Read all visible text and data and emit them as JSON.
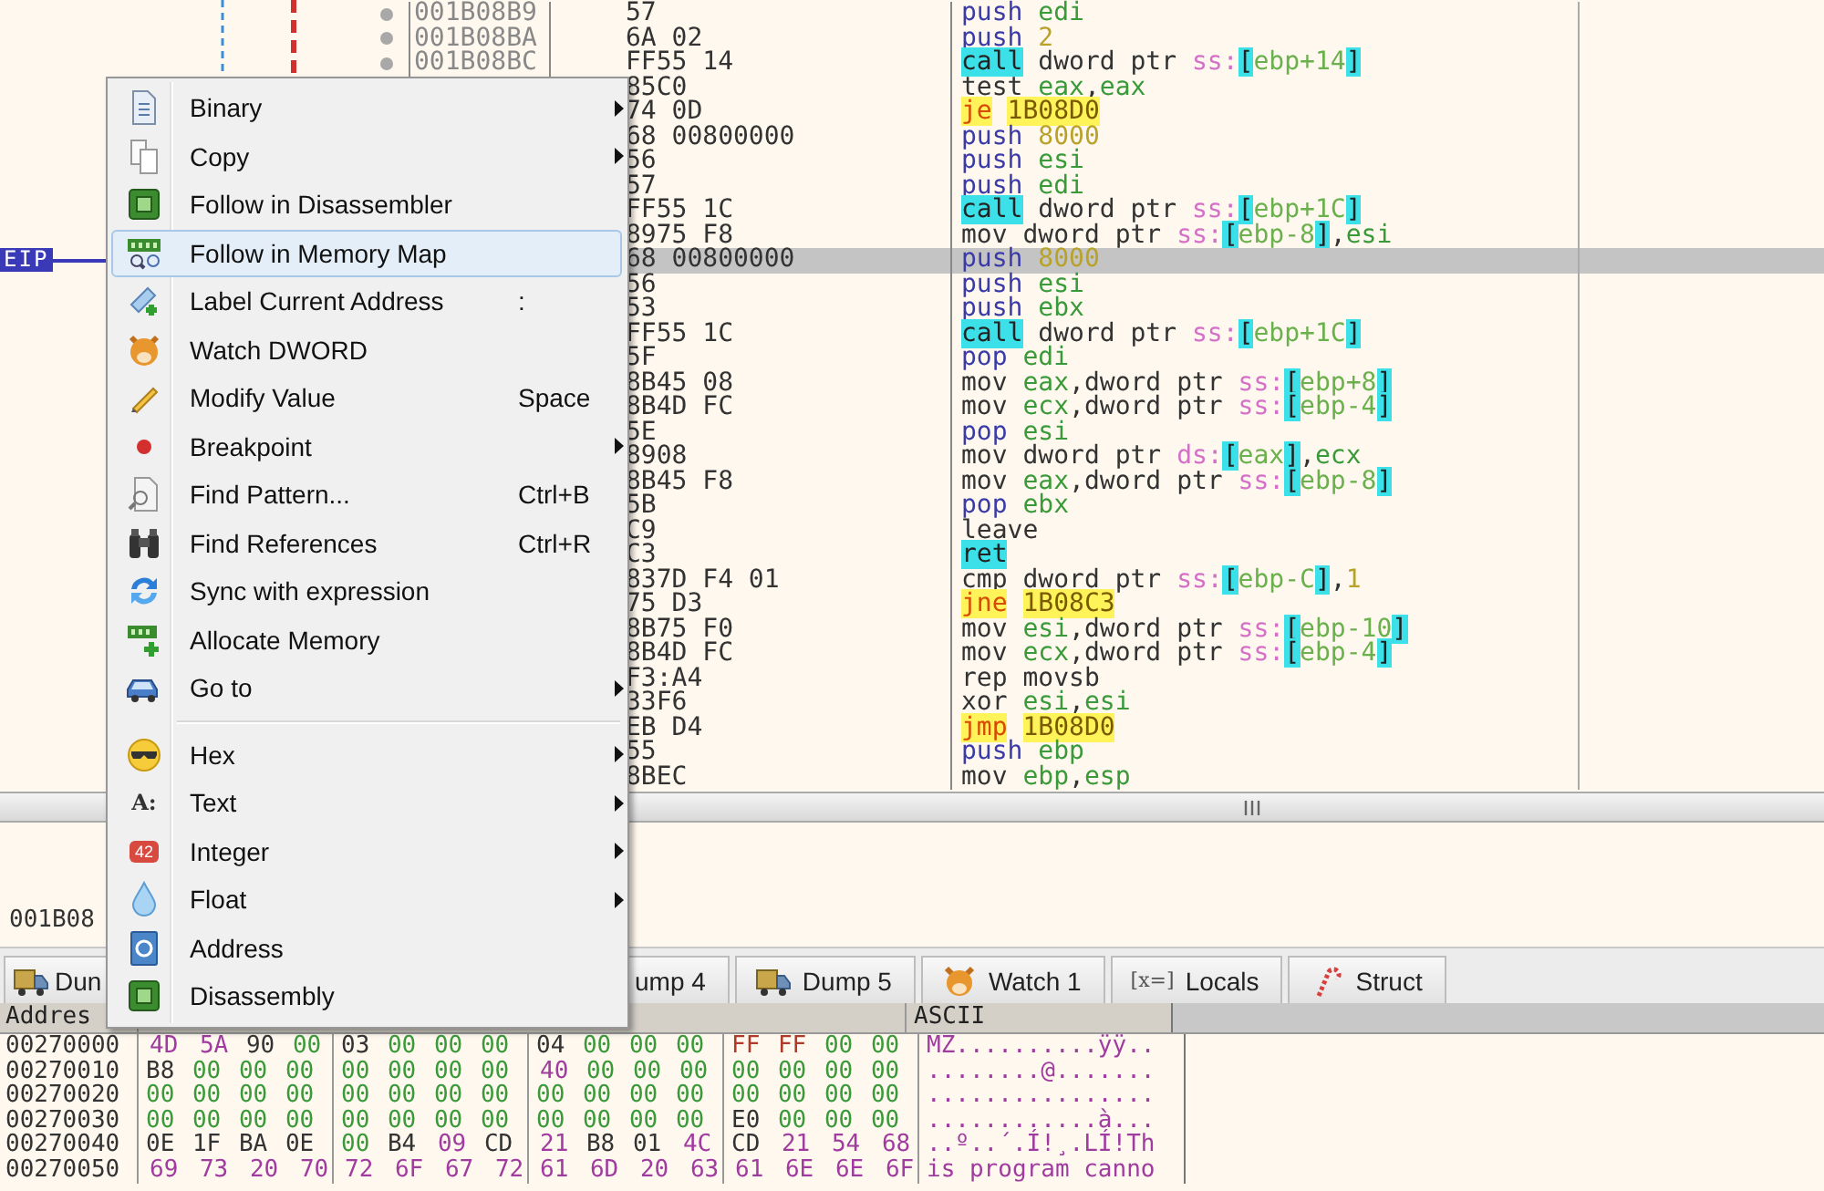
{
  "disassembly": {
    "rows": [
      {
        "address": "001B08B9",
        "bytes": "57",
        "instruction": "push edi",
        "kind": "stack",
        "selected": false
      },
      {
        "address": "001B08BA",
        "bytes": "6A 02",
        "instruction": "push 2",
        "kind": "stack",
        "selected": false
      },
      {
        "address": "001B08BC",
        "bytes": "FF55 14",
        "instruction": "call dword ptr ss:[ebp+14]",
        "kind": "call",
        "selected": false
      },
      {
        "bytes": "85C0",
        "instruction": "test eax,eax",
        "kind": "plain",
        "selected": false
      },
      {
        "bytes": "74 0D",
        "instruction": "je 1B08D0",
        "kind": "jump",
        "selected": false
      },
      {
        "bytes": "68 00800000",
        "instruction": "push 8000",
        "kind": "stack",
        "selected": false
      },
      {
        "bytes": "56",
        "instruction": "push esi",
        "kind": "stack",
        "selected": false
      },
      {
        "bytes": "57",
        "instruction": "push edi",
        "kind": "stack",
        "selected": false
      },
      {
        "bytes": "FF55 1C",
        "instruction": "call dword ptr ss:[ebp+1C]",
        "kind": "call",
        "selected": false
      },
      {
        "bytes": "8975 F8",
        "instruction": "mov dword ptr ss:[ebp-8],esi",
        "kind": "plain",
        "selected": false
      },
      {
        "bytes": "68 00800000",
        "instruction": "push 8000",
        "kind": "stack",
        "selected": true,
        "eip_label": "EIP"
      },
      {
        "bytes": "56",
        "instruction": "push esi",
        "kind": "stack",
        "selected": false
      },
      {
        "bytes": "53",
        "instruction": "push ebx",
        "kind": "stack",
        "selected": false
      },
      {
        "bytes": "FF55 1C",
        "instruction": "call dword ptr ss:[ebp+1C]",
        "kind": "call",
        "selected": false
      },
      {
        "bytes": "5F",
        "instruction": "pop edi",
        "kind": "stack",
        "selected": false
      },
      {
        "bytes": "8B45 08",
        "instruction": "mov eax,dword ptr ss:[ebp+8]",
        "kind": "plain",
        "selected": false
      },
      {
        "bytes": "8B4D FC",
        "instruction": "mov ecx,dword ptr ss:[ebp-4]",
        "kind": "plain",
        "selected": false
      },
      {
        "bytes": "5E",
        "instruction": "pop esi",
        "kind": "stack",
        "selected": false
      },
      {
        "bytes": "8908",
        "instruction": "mov dword ptr ds:[eax],ecx",
        "kind": "plain",
        "selected": false
      },
      {
        "bytes": "8B45 F8",
        "instruction": "mov eax,dword ptr ss:[ebp-8]",
        "kind": "plain",
        "selected": false
      },
      {
        "bytes": "5B",
        "instruction": "pop ebx",
        "kind": "stack",
        "selected": false
      },
      {
        "bytes": "C9",
        "instruction": "leave",
        "kind": "plain",
        "selected": false
      },
      {
        "bytes": "C3",
        "instruction": "ret",
        "kind": "ret",
        "selected": false
      },
      {
        "bytes": "837D F4 01",
        "instruction": "cmp dword ptr ss:[ebp-C],1",
        "kind": "plain",
        "selected": false
      },
      {
        "bytes": "75 D3",
        "instruction": "jne 1B08C3",
        "kind": "jump",
        "selected": false
      },
      {
        "bytes": "8B75 F0",
        "instruction": "mov esi,dword ptr ss:[ebp-10]",
        "kind": "plain",
        "selected": false
      },
      {
        "bytes": "8B4D FC",
        "instruction": "mov ecx,dword ptr ss:[ebp-4]",
        "kind": "plain",
        "selected": false
      },
      {
        "bytes": "F3:A4",
        "instruction": "rep movsb",
        "kind": "string",
        "selected": false
      },
      {
        "bytes": "33F6",
        "instruction": "xor esi,esi",
        "kind": "plain",
        "selected": false
      },
      {
        "bytes": "EB D4",
        "instruction": "jmp 1B08D0",
        "kind": "jump",
        "selected": false
      },
      {
        "bytes": "55",
        "instruction": "push ebp",
        "kind": "stack",
        "selected": false
      },
      {
        "bytes": "8BEC",
        "instruction": "mov ebp,esp",
        "kind": "plain",
        "selected": false
      }
    ]
  },
  "info_pane": {
    "text": "001B08"
  },
  "tabs": [
    {
      "label": "Dun",
      "kind": "dump"
    },
    {
      "label": "ump 4",
      "kind": "plain"
    },
    {
      "label": "Dump 5",
      "kind": "dump"
    },
    {
      "label": "Watch 1",
      "kind": "watch"
    },
    {
      "label": "Locals",
      "kind": "locals",
      "glyph": "[x=]"
    },
    {
      "label": "Struct",
      "kind": "struct"
    }
  ],
  "dump": {
    "header": {
      "address": "Addres",
      "ascii": "ASCII"
    },
    "rows": [
      {
        "address": "00270000",
        "bytes": "4D 5A 90 00 03 00 00 00 04 00 00 00 FF FF 00 00",
        "ascii": "MZ..........ÿÿ.."
      },
      {
        "address": "00270010",
        "bytes": "B8 00 00 00 00 00 00 00 40 00 00 00 00 00 00 00",
        "ascii": "........@......."
      },
      {
        "address": "00270020",
        "bytes": "00 00 00 00 00 00 00 00 00 00 00 00 00 00 00 00",
        "ascii": "................"
      },
      {
        "address": "00270030",
        "bytes": "00 00 00 00 00 00 00 00 00 00 00 00 E0 00 00 00",
        "ascii": "............à..."
      },
      {
        "address": "00270040",
        "bytes": "0E 1F BA 0E 00 B4 09 CD 21 B8 01 4C CD 21 54 68",
        "ascii": "..º..´.Í!¸.LÍ!Th"
      },
      {
        "address": "00270050",
        "bytes": "69 73 20 70 72 6F 67 72 61 6D 20 63 61 6E 6E 6F",
        "ascii": "is program canno"
      }
    ]
  },
  "context_menu": {
    "items": [
      {
        "kind": "item",
        "label": "Binary",
        "submenu": true,
        "selected": false
      },
      {
        "kind": "item",
        "label": "Copy",
        "submenu": true,
        "selected": false
      },
      {
        "kind": "item",
        "label": "Follow in Disassembler",
        "submenu": false,
        "selected": false
      },
      {
        "kind": "item",
        "label": "Follow in Memory Map",
        "submenu": false,
        "selected": true
      },
      {
        "kind": "item",
        "label": "Label Current Address",
        "shortcut": ":",
        "submenu": false,
        "selected": false
      },
      {
        "kind": "item",
        "label": "Watch DWORD",
        "submenu": false,
        "selected": false
      },
      {
        "kind": "item",
        "label": "Modify Value",
        "shortcut": "Space",
        "submenu": false,
        "selected": false
      },
      {
        "kind": "item",
        "label": "Breakpoint",
        "submenu": true,
        "selected": false
      },
      {
        "kind": "item",
        "label": "Find Pattern...",
        "shortcut": "Ctrl+B",
        "submenu": false,
        "selected": false
      },
      {
        "kind": "item",
        "label": "Find References",
        "shortcut": "Ctrl+R",
        "submenu": false,
        "selected": false
      },
      {
        "kind": "item",
        "label": "Sync with expression",
        "submenu": false,
        "selected": false
      },
      {
        "kind": "item",
        "label": "Allocate Memory",
        "submenu": false,
        "selected": false
      },
      {
        "kind": "item",
        "label": "Go to",
        "submenu": true,
        "selected": false
      },
      {
        "kind": "separator"
      },
      {
        "kind": "item",
        "label": "Hex",
        "submenu": true,
        "selected": false
      },
      {
        "kind": "item",
        "label": "Text",
        "glyph": "A:",
        "submenu": true,
        "selected": false
      },
      {
        "kind": "item",
        "label": "Integer",
        "glyph": "42",
        "submenu": true,
        "selected": false
      },
      {
        "kind": "item",
        "label": "Float",
        "submenu": true,
        "selected": false
      },
      {
        "kind": "item",
        "label": "Address",
        "submenu": false,
        "selected": false
      },
      {
        "kind": "item",
        "label": "Disassembly",
        "submenu": false,
        "selected": false
      }
    ]
  }
}
